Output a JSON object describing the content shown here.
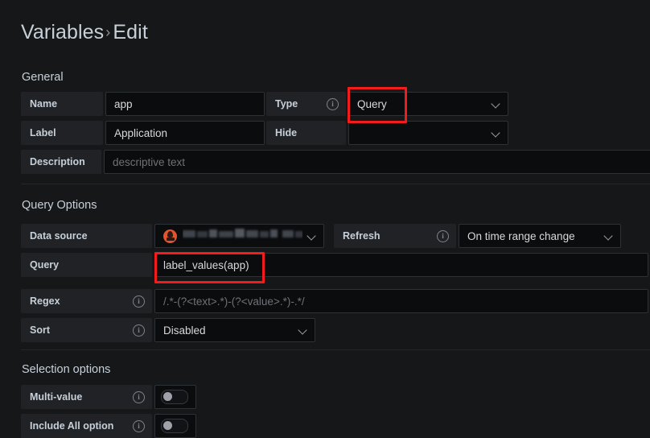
{
  "header": {
    "breadcrumb_parent": "Variables",
    "breadcrumb_separator": "›",
    "breadcrumb_current": "Edit"
  },
  "sections": {
    "general": "General",
    "query_options": "Query Options",
    "selection_options": "Selection options"
  },
  "general": {
    "name": {
      "label": "Name",
      "value": "app"
    },
    "label": {
      "label": "Label",
      "value": "Application"
    },
    "description": {
      "label": "Description",
      "placeholder": "descriptive text",
      "value": ""
    },
    "type": {
      "label": "Type",
      "value": "Query"
    },
    "hide": {
      "label": "Hide",
      "value": ""
    }
  },
  "query_options": {
    "data_source": {
      "label": "Data source",
      "value": "",
      "icon": "prometheus-icon",
      "redacted": true
    },
    "refresh": {
      "label": "Refresh",
      "value": "On time range change"
    },
    "query": {
      "label": "Query",
      "value": "label_values(app)"
    },
    "regex": {
      "label": "Regex",
      "placeholder": "/.*-(?<text>.*)-(?<value>.*)-.*/",
      "value": ""
    },
    "sort": {
      "label": "Sort",
      "value": "Disabled"
    }
  },
  "selection_options": {
    "multi_value": {
      "label": "Multi-value",
      "state": "off"
    },
    "include_all": {
      "label": "Include All option",
      "state": "off"
    }
  },
  "colors": {
    "background": "#161719",
    "panel": "#202226",
    "input": "#0b0c0e",
    "border": "#2c3235",
    "text": "#d8d9da",
    "muted": "#6e7277",
    "annotation": "#f21c1c",
    "prometheus": "#e6522c"
  },
  "annotations": [
    {
      "name": "type-value-highlight",
      "target": "Query"
    },
    {
      "name": "query-value-highlight",
      "target": "label_values(app)"
    }
  ]
}
